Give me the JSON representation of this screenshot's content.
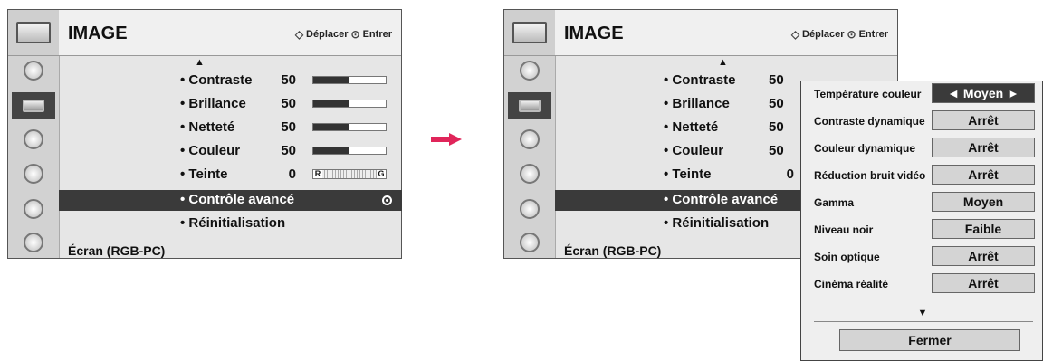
{
  "left": {
    "title": "IMAGE",
    "hint": {
      "move": "Déplacer",
      "enter": "Entrer"
    },
    "items": [
      {
        "label": "• Contraste",
        "value": "50",
        "level": 0.5
      },
      {
        "label": "• Brillance",
        "value": "50",
        "level": 0.5
      },
      {
        "label": "• Netteté",
        "value": "50",
        "level": 0.5
      },
      {
        "label": "• Couleur",
        "value": "50",
        "level": 0.5
      },
      {
        "label": "• Teinte",
        "value": "0",
        "tint_left": "R",
        "tint_right": "G"
      },
      {
        "label": "• Contrôle avancé"
      },
      {
        "label": "• Réinitialisation"
      }
    ],
    "footer": "Écran (RGB-PC)"
  },
  "right": {
    "title": "IMAGE",
    "hint": {
      "move": "Déplacer",
      "enter": "Entrer"
    },
    "items": [
      {
        "label": "• Contraste",
        "value": "50"
      },
      {
        "label": "• Brillance",
        "value": "50"
      },
      {
        "label": "• Netteté",
        "value": "50"
      },
      {
        "label": "• Couleur",
        "value": "50"
      },
      {
        "label": "• Teinte",
        "value": "0"
      },
      {
        "label": "• Contrôle avancé"
      },
      {
        "label": "• Réinitialisation"
      }
    ],
    "footer": "Écran (RGB-PC)"
  },
  "popup": {
    "rows": [
      {
        "label": "Température couleur",
        "value": "◄ Moyen ►"
      },
      {
        "label": "Contraste dynamique",
        "value": "Arrêt"
      },
      {
        "label": "Couleur dynamique",
        "value": "Arrêt"
      },
      {
        "label": "Réduction bruit vidéo",
        "value": "Arrêt"
      },
      {
        "label": "Gamma",
        "value": "Moyen"
      },
      {
        "label": "Niveau noir",
        "value": "Faible"
      },
      {
        "label": "Soin optique",
        "value": "Arrêt"
      },
      {
        "label": "Cinéma réalité",
        "value": "Arrêt"
      }
    ],
    "close_label": "Fermer"
  },
  "colors": {
    "arrow": "#e0255a",
    "selected": "#3a3a3a",
    "panel_bg": "#e6e6e6"
  },
  "icons": [
    "picture-icon",
    "tv-icon",
    "audio-icon",
    "clock-icon",
    "option-icon",
    "lock-icon"
  ]
}
